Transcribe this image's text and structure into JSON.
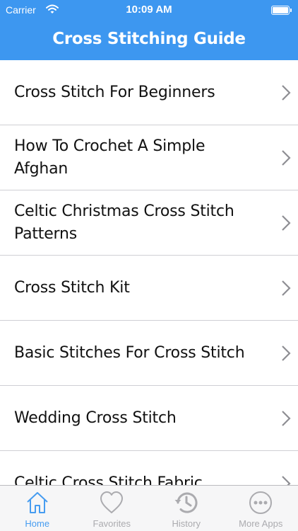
{
  "status": {
    "carrier": "Carrier",
    "time": "10:09 AM"
  },
  "header": {
    "title": "Cross Stitching Guide"
  },
  "list": {
    "items": [
      {
        "label": "Cross Stitch For Beginners"
      },
      {
        "label": "How To Crochet A Simple Afghan"
      },
      {
        "label": "Celtic Christmas Cross Stitch Patterns"
      },
      {
        "label": "Cross Stitch Kit"
      },
      {
        "label": "Basic Stitches For Cross Stitch"
      },
      {
        "label": "Wedding Cross Stitch"
      },
      {
        "label": "Celtic Cross Stitch Fabric"
      }
    ]
  },
  "tabs": {
    "items": [
      {
        "label": "Home",
        "icon": "house-icon",
        "active": true
      },
      {
        "label": "Favorites",
        "icon": "heart-icon",
        "active": false
      },
      {
        "label": "History",
        "icon": "clock-history-icon",
        "active": false
      },
      {
        "label": "More Apps",
        "icon": "more-icon",
        "active": false
      }
    ]
  },
  "colors": {
    "accent": "#3d97f0",
    "inactive_tab": "#a7a7ab",
    "separator": "#cfcfd4"
  }
}
